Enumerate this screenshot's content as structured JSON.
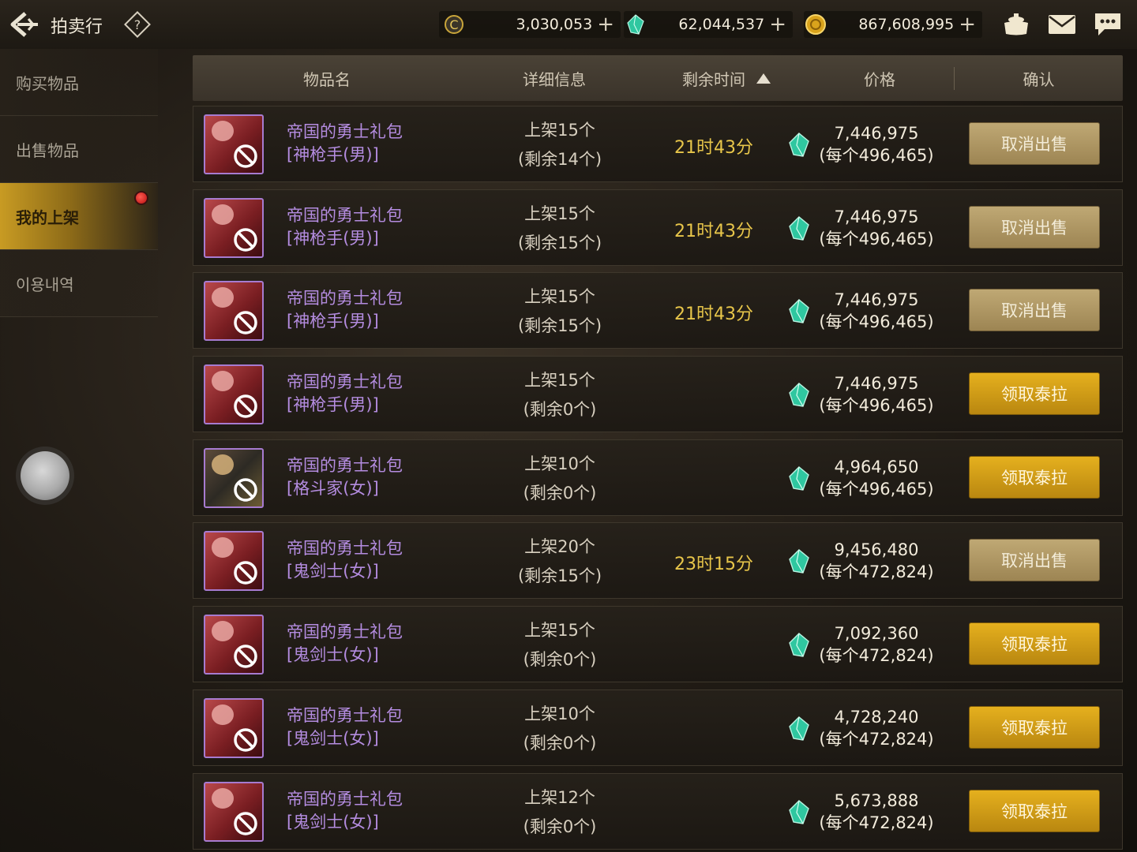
{
  "header": {
    "title": "拍卖行",
    "currencies": [
      {
        "icon": "coin-c-icon",
        "value": "3,030,053"
      },
      {
        "icon": "tera-gem-icon",
        "value": "62,044,537"
      },
      {
        "icon": "gold-coin-icon",
        "value": "867,608,995"
      }
    ]
  },
  "sidebar": {
    "items": [
      {
        "label": "购买物品"
      },
      {
        "label": "出售物品"
      },
      {
        "label": "我的上架"
      },
      {
        "label": "이용내역"
      }
    ]
  },
  "table": {
    "headers": {
      "name": "物品名",
      "detail": "详细信息",
      "time": "剩余时间",
      "price": "价格",
      "confirm": "确认"
    },
    "rows": [
      {
        "name1": "帝国的勇士礼包",
        "name2": "[神枪手(男)]",
        "detail1": "上架15个",
        "detail2": "(剩余14个)",
        "time": "21时43分",
        "price1": "7,446,975",
        "price2": "(每个496,465)",
        "action": "取消出售",
        "thumb": "red"
      },
      {
        "name1": "帝国的勇士礼包",
        "name2": "[神枪手(男)]",
        "detail1": "上架15个",
        "detail2": "(剩余15个)",
        "time": "21时43分",
        "price1": "7,446,975",
        "price2": "(每个496,465)",
        "action": "取消出售",
        "thumb": "red"
      },
      {
        "name1": "帝国的勇士礼包",
        "name2": "[神枪手(男)]",
        "detail1": "上架15个",
        "detail2": "(剩余15个)",
        "time": "21时43分",
        "price1": "7,446,975",
        "price2": "(每个496,465)",
        "action": "取消出售",
        "thumb": "red"
      },
      {
        "name1": "帝国的勇士礼包",
        "name2": "[神枪手(男)]",
        "detail1": "上架15个",
        "detail2": "(剩余0个)",
        "time": "",
        "price1": "7,446,975",
        "price2": "(每个496,465)",
        "action": "领取泰拉",
        "thumb": "red"
      },
      {
        "name1": "帝国的勇士礼包",
        "name2": "[格斗家(女)]",
        "detail1": "上架10个",
        "detail2": "(剩余0个)",
        "time": "",
        "price1": "4,964,650",
        "price2": "(每个496,465)",
        "action": "领取泰拉",
        "thumb": "alt"
      },
      {
        "name1": "帝国的勇士礼包",
        "name2": "[鬼剑士(女)]",
        "detail1": "上架20个",
        "detail2": "(剩余15个)",
        "time": "23时15分",
        "price1": "9,456,480",
        "price2": "(每个472,824)",
        "action": "取消出售",
        "thumb": "red"
      },
      {
        "name1": "帝国的勇士礼包",
        "name2": "[鬼剑士(女)]",
        "detail1": "上架15个",
        "detail2": "(剩余0个)",
        "time": "",
        "price1": "7,092,360",
        "price2": "(每个472,824)",
        "action": "领取泰拉",
        "thumb": "red"
      },
      {
        "name1": "帝国的勇士礼包",
        "name2": "[鬼剑士(女)]",
        "detail1": "上架10个",
        "detail2": "(剩余0个)",
        "time": "",
        "price1": "4,728,240",
        "price2": "(每个472,824)",
        "action": "领取泰拉",
        "thumb": "red"
      },
      {
        "name1": "帝国的勇士礼包",
        "name2": "[鬼剑士(女)]",
        "detail1": "上架12个",
        "detail2": "(剩余0个)",
        "time": "",
        "price1": "5,673,888",
        "price2": "(每个472,824)",
        "action": "领取泰拉",
        "thumb": "red"
      }
    ]
  }
}
